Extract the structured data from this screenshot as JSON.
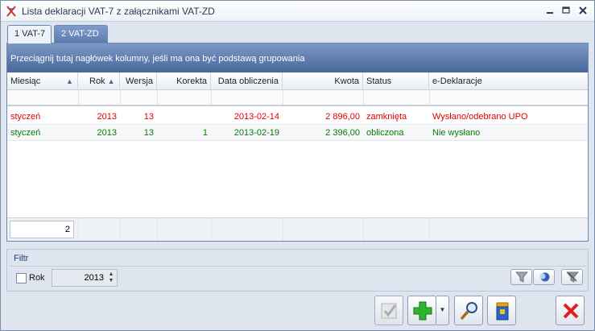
{
  "window": {
    "title": "Lista deklaracji VAT-7 z załącznikami VAT-ZD"
  },
  "tabs": [
    {
      "label": "1 VAT-7",
      "active": true
    },
    {
      "label": "2 VAT-ZD",
      "active": false
    }
  ],
  "grid": {
    "group_hint": "Przeciągnij tutaj nagłówek kolumny, jeśli ma ona być podstawą grupowania",
    "columns": [
      "Miesiąc",
      "Rok",
      "Wersja",
      "Korekta",
      "Data obliczenia",
      "Kwota",
      "Status",
      "e-Deklaracje"
    ],
    "rows": [
      {
        "miesiac": "styczeń",
        "rok": "2013",
        "wersja": "13",
        "korekta": "",
        "data": "2013-02-14",
        "kwota": "2 896,00",
        "status": "zamknięta",
        "edeklaracje": "Wysłano/odebrano UPO",
        "color": "#e00000"
      },
      {
        "miesiac": "styczeń",
        "rok": "2013",
        "wersja": "13",
        "korekta": "1",
        "data": "2013-02-19",
        "kwota": "2 396,00",
        "status": "obliczona",
        "edeklaracje": "Nie wysłano",
        "color": "#0b7a0b"
      }
    ],
    "row_count": "2"
  },
  "filter": {
    "title": "Filtr",
    "rok_label": "Rok",
    "rok_checked": false,
    "year_value": "2013"
  },
  "icons": {
    "app": "app-logo-icon",
    "filter": "funnel-icon",
    "filter_active": "funnel-active-icon",
    "filter_clear": "funnel-clear-icon",
    "approve": "checkmark-icon",
    "add": "plus-icon",
    "preview": "magnifier-icon",
    "trash": "trash-bin-icon",
    "close": "close-x-icon"
  },
  "colors": {
    "closed_row": "#e00000",
    "computed_row": "#0b7a0b",
    "accent": "#49679a"
  }
}
